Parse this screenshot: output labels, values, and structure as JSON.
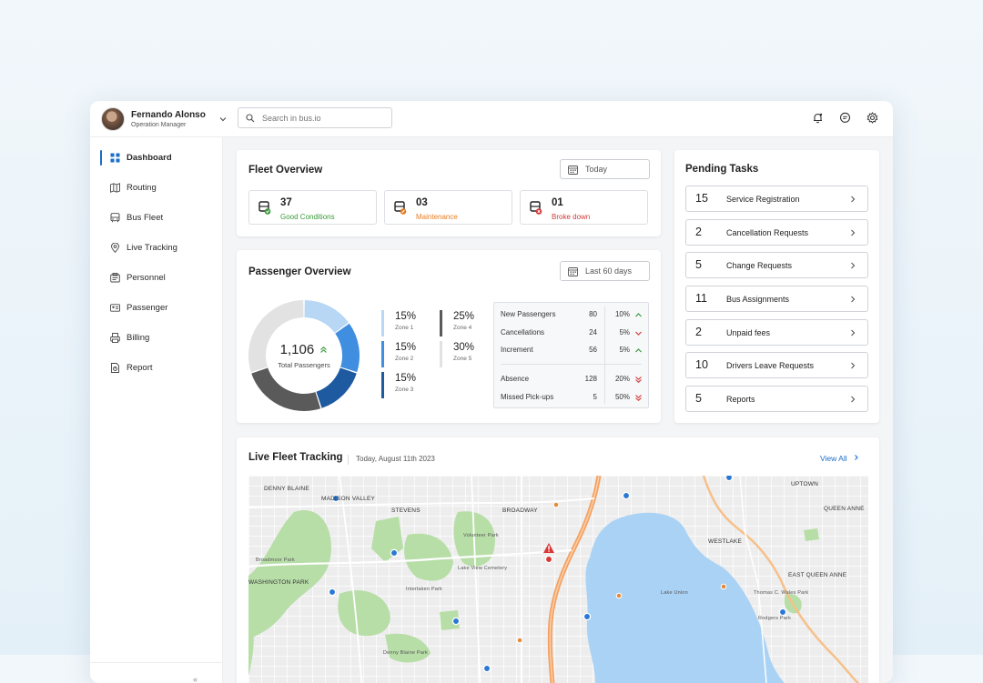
{
  "user": {
    "name": "Fernando Alonso",
    "role": "Operation Manager"
  },
  "search": {
    "placeholder": "Search in bus.io"
  },
  "topbar_icons": [
    "bell-icon",
    "chat-icon",
    "gear-icon"
  ],
  "sidebar": {
    "items": [
      {
        "label": "Dashboard",
        "icon": "dashboard-icon",
        "active": true
      },
      {
        "label": "Routing",
        "icon": "map-icon",
        "active": false
      },
      {
        "label": "Bus Fleet",
        "icon": "bus-icon",
        "active": false
      },
      {
        "label": "Live Tracking",
        "icon": "location-pin-icon",
        "active": false
      },
      {
        "label": "Personnel",
        "icon": "personnel-icon",
        "active": false
      },
      {
        "label": "Passenger",
        "icon": "id-card-icon",
        "active": false
      },
      {
        "label": "Billing",
        "icon": "billing-icon",
        "active": false
      },
      {
        "label": "Report",
        "icon": "report-icon",
        "active": false
      }
    ],
    "collapse_glyph": "«"
  },
  "fleet_overview": {
    "title": "Fleet Overview",
    "date_filter": "Today",
    "stats": [
      {
        "value": "37",
        "label": "Good Conditions",
        "color": "#3a9a3a"
      },
      {
        "value": "03",
        "label": "Maintenance",
        "color": "#e67e22"
      },
      {
        "value": "01",
        "label": "Broke down",
        "color": "#d23c3c"
      }
    ]
  },
  "passenger_overview": {
    "title": "Passenger Overview",
    "date_filter": "Last 60 days",
    "total_value": "1,106",
    "total_label": "Total Passengers",
    "zones": [
      {
        "pct": "15%",
        "label": "Zone 1",
        "color": "#b7d7f5",
        "share": 0.15
      },
      {
        "pct": "15%",
        "label": "Zone 2",
        "color": "#3f8ee0",
        "share": 0.15
      },
      {
        "pct": "15%",
        "label": "Zone 3",
        "color": "#1e5aa0",
        "share": 0.15
      },
      {
        "pct": "25%",
        "label": "Zone 4",
        "color": "#5a5a5a",
        "share": 0.25
      },
      {
        "pct": "30%",
        "label": "Zone 5",
        "color": "#e2e2e2",
        "share": 0.3
      }
    ],
    "table": [
      {
        "label": "New Passengers",
        "value": "80",
        "pct": "10%",
        "trend": "up"
      },
      {
        "label": "Cancellations",
        "value": "24",
        "pct": "5%",
        "trend": "down"
      },
      {
        "label": "Increment",
        "value": "56",
        "pct": "5%",
        "trend": "up"
      },
      {
        "label": "Absence",
        "value": "128",
        "pct": "20%",
        "trend": "double-down"
      },
      {
        "label": "Missed Pick-ups",
        "value": "5",
        "pct": "50%",
        "trend": "double-down"
      }
    ]
  },
  "pending_tasks": {
    "title": "Pending Tasks",
    "items": [
      {
        "count": "15",
        "label": "Service Registration"
      },
      {
        "count": "2",
        "label": "Cancellation Requests"
      },
      {
        "count": "5",
        "label": "Change Requests"
      },
      {
        "count": "11",
        "label": "Bus Assignments"
      },
      {
        "count": "2",
        "label": "Unpaid fees"
      },
      {
        "count": "10",
        "label": "Drivers Leave Requests"
      },
      {
        "count": "5",
        "label": "Reports"
      }
    ]
  },
  "live_tracking": {
    "title": "Live Fleet Tracking",
    "date": "Today, August 11th 2023",
    "view_all": "View All",
    "map_labels": [
      "DENNY BLAINE",
      "MADISON VALLEY",
      "STEVENS",
      "BROADWAY",
      "UPTOWN",
      "QUEEN ANNE",
      "WESTLAKE",
      "WASHINGTON PARK",
      "EAST QUEEN ANNE",
      "Lake Union",
      "Volunteer Park",
      "Lake View Cemetery",
      "Broadmoor Park",
      "Interlaken Park",
      "Thomas C. Wales Park",
      "Denny Blaine Park",
      "Rodgers Park"
    ],
    "colors": {
      "water": "#a9d2f5",
      "park": "#b8dea8",
      "highway": "#f4a062",
      "bus_marker": "#2a78d4",
      "alert_marker": "#d93636"
    }
  },
  "colors": {
    "accent": "#1a6fc4"
  }
}
